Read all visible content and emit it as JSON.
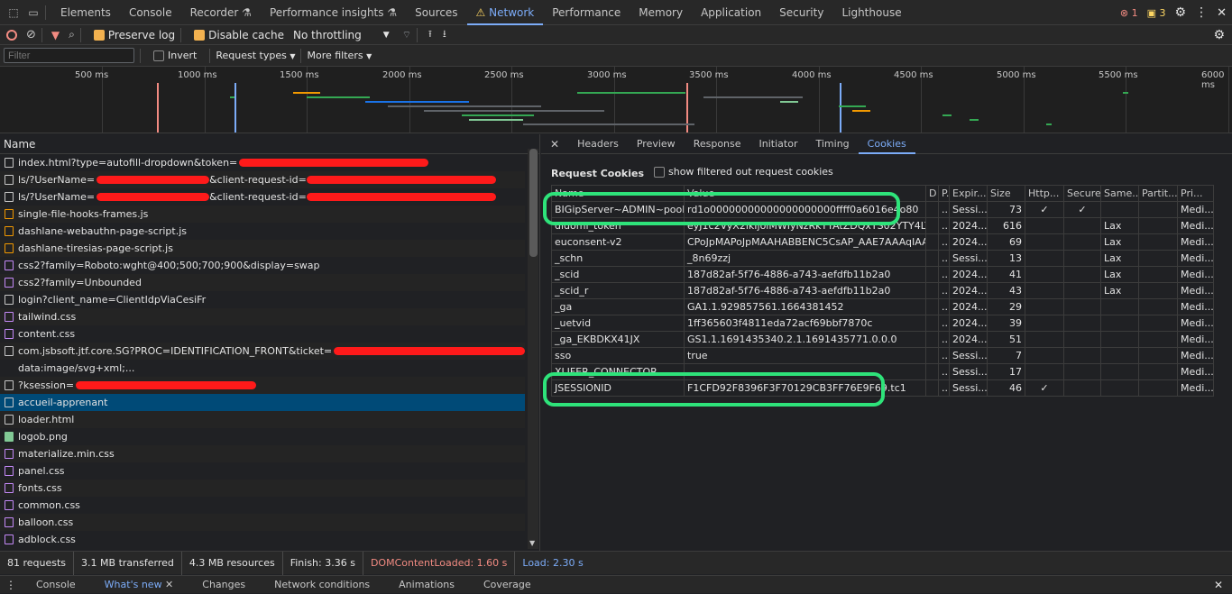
{
  "tabbar": {
    "tabs": [
      "Elements",
      "Console",
      "Recorder",
      "Performance insights",
      "Sources",
      "Network",
      "Performance",
      "Memory",
      "Application",
      "Security",
      "Lighthouse"
    ],
    "active": "Network",
    "errors": "1",
    "warnings": "3"
  },
  "toolbar": {
    "preserve_log": "Preserve log",
    "disable_cache": "Disable cache",
    "throttling": "No throttling"
  },
  "filterbar": {
    "filter_placeholder": "Filter",
    "invert": "Invert",
    "request_types": "Request types",
    "more_filters": "More filters"
  },
  "overview": {
    "ticks": [
      "500 ms",
      "1000 ms",
      "1500 ms",
      "2000 ms",
      "2500 ms",
      "3000 ms",
      "3500 ms",
      "4000 ms",
      "4500 ms",
      "5000 ms",
      "5500 ms",
      "6000 ms"
    ]
  },
  "list": {
    "header": "Name",
    "rows": [
      {
        "name": "index.html?type=autofill-dropdown&token=",
        "type": "doc",
        "redact": [
          210
        ]
      },
      {
        "name": "ls/?UserName=",
        "type": "doc",
        "suffix": "&client-request-id=",
        "redact": [
          125,
          210
        ]
      },
      {
        "name": "ls/?UserName=",
        "type": "doc",
        "suffix": "&client-request-id=",
        "redact": [
          125,
          210
        ]
      },
      {
        "name": "single-file-hooks-frames.js",
        "type": "js"
      },
      {
        "name": "dashlane-webauthn-page-script.js",
        "type": "js"
      },
      {
        "name": "dashlane-tiresias-page-script.js",
        "type": "js"
      },
      {
        "name": "css2?family=Roboto:wght@400;500;700;900&display=swap",
        "type": "css"
      },
      {
        "name": "css2?family=Unbounded",
        "type": "css"
      },
      {
        "name": "login?client_name=ClientIdpViaCesiFr",
        "type": "doc"
      },
      {
        "name": "tailwind.css",
        "type": "css"
      },
      {
        "name": "content.css",
        "type": "css"
      },
      {
        "name": "com.jsbsoft.jtf.core.SG?PROC=IDENTIFICATION_FRONT&ticket=",
        "type": "doc",
        "redact": [
          225
        ]
      },
      {
        "name": "data:image/svg+xml;...",
        "type": "data"
      },
      {
        "name": "?ksession=",
        "type": "doc",
        "redact": [
          200
        ]
      },
      {
        "name": "accueil-apprenant",
        "type": "doc",
        "selected": true
      },
      {
        "name": "loader.html",
        "type": "doc"
      },
      {
        "name": "logob.png",
        "type": "img"
      },
      {
        "name": "materialize.min.css",
        "type": "css"
      },
      {
        "name": "panel.css",
        "type": "css"
      },
      {
        "name": "fonts.css",
        "type": "css"
      },
      {
        "name": "common.css",
        "type": "css"
      },
      {
        "name": "balloon.css",
        "type": "css"
      },
      {
        "name": "adblock.css",
        "type": "css"
      }
    ]
  },
  "detail": {
    "tabs": [
      "Headers",
      "Preview",
      "Response",
      "Initiator",
      "Timing",
      "Cookies"
    ],
    "active": "Cookies",
    "section_title": "Request Cookies",
    "show_filtered": "show filtered out request cookies",
    "columns": [
      "Name",
      "Value",
      "D",
      "P.",
      "Expir...",
      "Size",
      "Http...",
      "Secure",
      "Same...",
      "Partit...",
      "Pri..."
    ],
    "cookies": [
      [
        "BIGipServer~ADMIN~pool-...",
        "rd1o00000000000000000000ffff0a6016e4o80",
        "",
        ".../",
        "Sessi...",
        "73",
        "✓",
        "✓",
        "",
        "",
        "Medi..."
      ],
      [
        "didomi_token",
        "eyJ1c2VyX2lkIjoiMWIyNzRkYTAtZDQxYS02YTY4LTlh...",
        "",
        ".../",
        "2024...",
        "616",
        "",
        "",
        "Lax",
        "",
        "Medi..."
      ],
      [
        "euconsent-v2",
        "CPoJpMAPoJpMAAHABBENC5CsAP_AAE7AAAqIAAA...",
        "",
        ".../",
        "2024...",
        "69",
        "",
        "",
        "Lax",
        "",
        "Medi..."
      ],
      [
        "_schn",
        "_8n69zzj",
        "",
        ".../",
        "Sessi...",
        "13",
        "",
        "",
        "Lax",
        "",
        "Medi..."
      ],
      [
        "_scid",
        "187d82af-5f76-4886-a743-aefdfb11b2a0",
        "",
        ".../",
        "2024...",
        "41",
        "",
        "",
        "Lax",
        "",
        "Medi..."
      ],
      [
        "_scid_r",
        "187d82af-5f76-4886-a743-aefdfb11b2a0",
        "",
        ".../",
        "2024...",
        "43",
        "",
        "",
        "Lax",
        "",
        "Medi..."
      ],
      [
        "_ga",
        "GA1.1.929857561.1664381452",
        "",
        ".../",
        "2024...",
        "29",
        "",
        "",
        "",
        "",
        "Medi..."
      ],
      [
        "_uetvid",
        "1ff365603f4811eda72acf69bbf7870c",
        "",
        ".../",
        "2024...",
        "39",
        "",
        "",
        "",
        "",
        "Medi..."
      ],
      [
        "_ga_EKBDKX41JX",
        "GS1.1.1691435340.2.1.1691435771.0.0.0",
        "",
        ".../",
        "2024...",
        "51",
        "",
        "",
        "",
        "",
        "Medi..."
      ],
      [
        "sso",
        "true",
        "",
        ".../",
        "Sessi...",
        "7",
        "",
        "",
        "",
        "",
        "Medi..."
      ],
      [
        "XLIFER_CONNECTOR",
        "",
        "",
        ".../",
        "Sessi...",
        "17",
        "",
        "",
        "",
        "",
        "Medi..."
      ],
      [
        "JSESSIONID",
        "F1CFD92F8396F3F70129CB3FF76E9F69.tc1",
        "",
        ".../",
        "Sessi...",
        "46",
        "✓",
        "",
        "",
        "",
        "Medi..."
      ]
    ]
  },
  "status": {
    "requests": "81 requests",
    "transferred": "3.1 MB transferred",
    "resources": "4.3 MB resources",
    "finish": "Finish: 3.36 s",
    "dcl": "DOMContentLoaded: 1.60 s",
    "load": "Load: 2.30 s"
  },
  "drawer": {
    "tabs": [
      "Console",
      "What's new",
      "Changes",
      "Network conditions",
      "Animations",
      "Coverage"
    ],
    "active": "What's new"
  },
  "colors": {
    "accent": "#7cacf8",
    "highlight": "#2ee37a",
    "redaction": "#ff1a1a",
    "dcl": "#f28b82",
    "load": "#7cacf8"
  }
}
